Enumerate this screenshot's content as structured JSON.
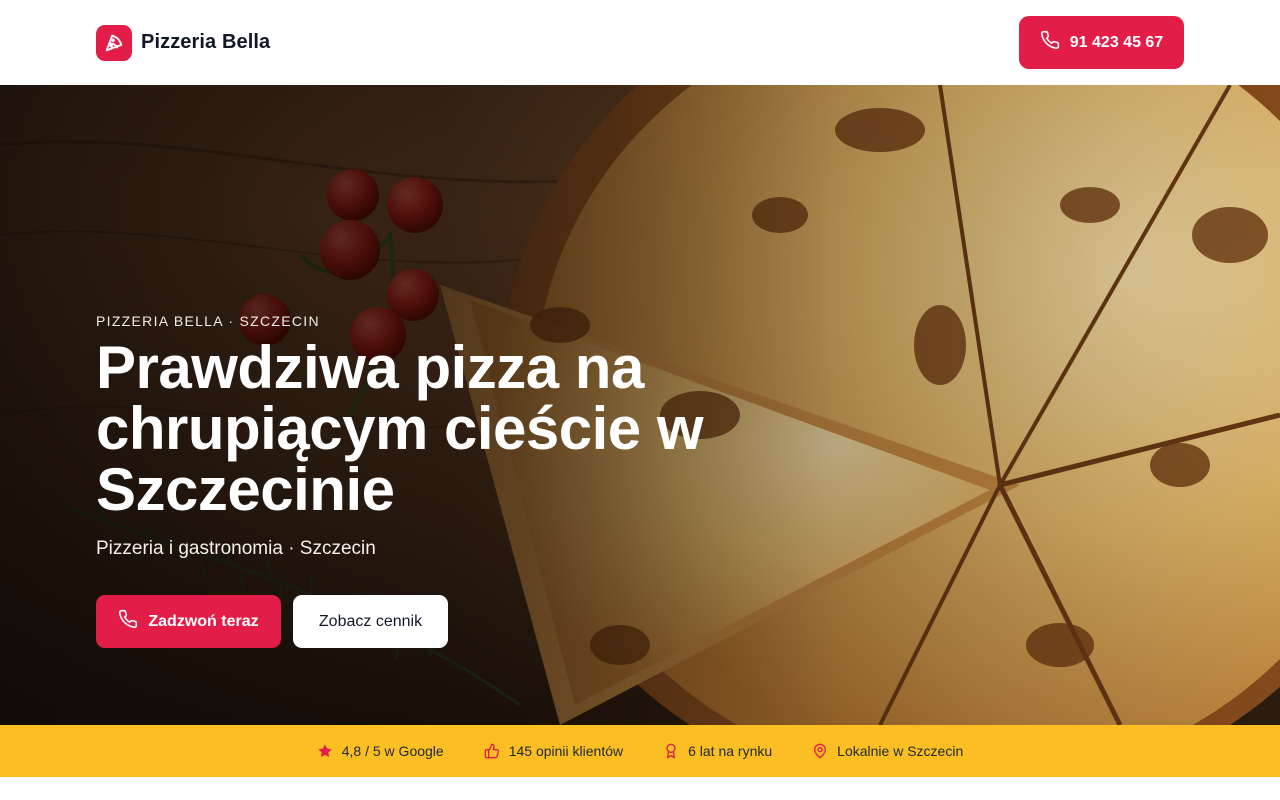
{
  "header": {
    "brand_name": "Pizzeria Bella",
    "logo_icon": "pizza-slice-icon",
    "phone_label": "91 423 45 67",
    "phone_icon": "phone-icon"
  },
  "hero": {
    "eyebrow": "PIZZERIA BELLA · SZCZECIN",
    "title": "Prawdziwa pizza na chrupiącym cieście w Szczecinie",
    "subtitle": "Pizzeria i gastronomia · Szczecin",
    "primary_cta": "Zadzwoń teraz",
    "secondary_cta": "Zobacz cennik",
    "background": "pizza-photo"
  },
  "stats": [
    {
      "icon": "star-icon",
      "label": "4,8 / 5 w Google"
    },
    {
      "icon": "thumbs-up-icon",
      "label": "145 opinii klientów"
    },
    {
      "icon": "award-icon",
      "label": "6 lat na rynku"
    },
    {
      "icon": "map-pin-icon",
      "label": "Lokalnie w Szczecin"
    }
  ],
  "colors": {
    "accent": "#e11d48",
    "stats_bar": "#fbbf24",
    "text_dark": "#111827"
  }
}
